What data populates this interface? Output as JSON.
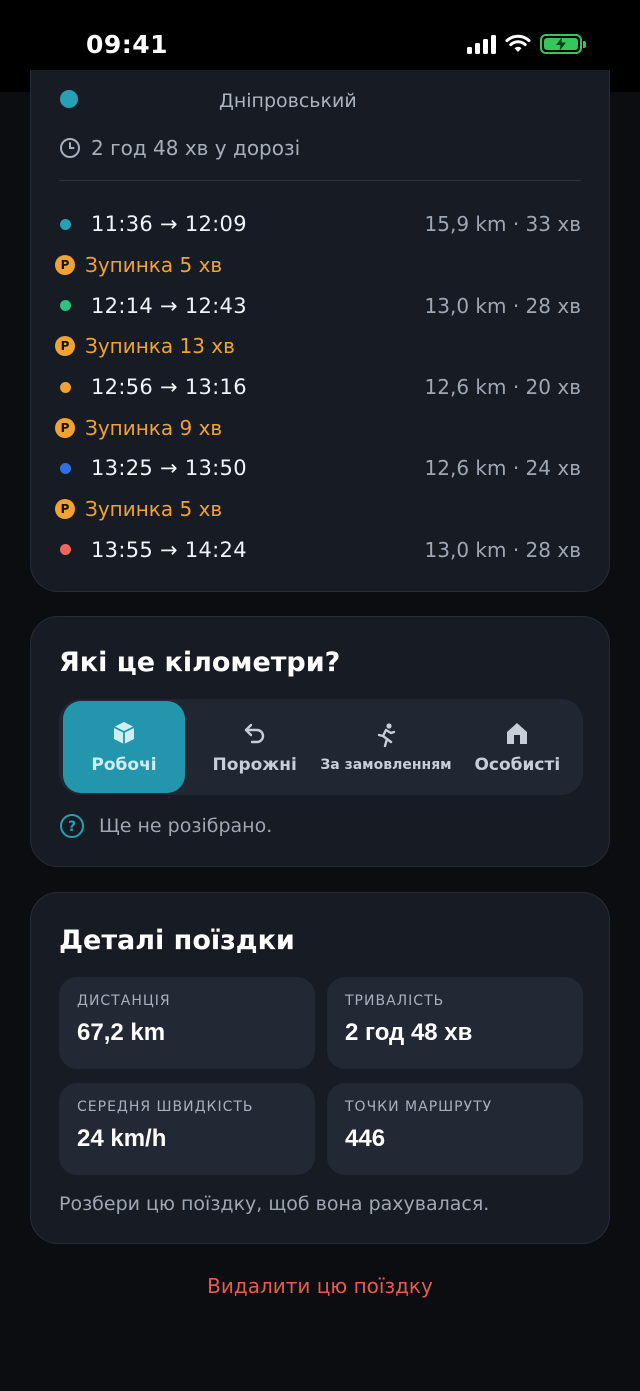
{
  "status": {
    "time": "09:41"
  },
  "trip": {
    "end_place": "Дніпровський",
    "duration_text": "2 год 48 хв у дорозі",
    "segments": [
      {
        "kind": "drive",
        "time": "11:36 → 12:09",
        "meta": "15,9 km · 33 хв",
        "color": "#26a0b5"
      },
      {
        "kind": "stop",
        "label": "Зупинка 5 хв"
      },
      {
        "kind": "drive",
        "time": "12:14 → 12:43",
        "meta": "13,0 km · 28 хв",
        "color": "#2ec27e"
      },
      {
        "kind": "stop",
        "label": "Зупинка 13 хв"
      },
      {
        "kind": "drive",
        "time": "12:56 → 13:16",
        "meta": "12,6 km · 20 хв",
        "color": "#f0a233"
      },
      {
        "kind": "stop",
        "label": "Зупинка 9 хв"
      },
      {
        "kind": "drive",
        "time": "13:25 → 13:50",
        "meta": "12,6 km · 24 хв",
        "color": "#2f6fe0"
      },
      {
        "kind": "stop",
        "label": "Зупинка 5 хв"
      },
      {
        "kind": "drive",
        "time": "13:55 → 14:24",
        "meta": "13,0 km · 28 хв",
        "color": "#f0665a"
      }
    ],
    "stop_badge": "P"
  },
  "category": {
    "title": "Які це кілометри?",
    "options": [
      {
        "label": "Робочі",
        "icon": "box-icon",
        "active": true
      },
      {
        "label": "Порожні",
        "icon": "return-arrow-icon",
        "active": false
      },
      {
        "label": "За замовленням",
        "icon": "running-person-icon",
        "active": false
      },
      {
        "label": "Особисті",
        "icon": "home-icon",
        "active": false
      }
    ],
    "hint": "Ще не розібрано."
  },
  "details": {
    "title": "Деталі поїздки",
    "stats": [
      {
        "label": "ДИСТАНЦІЯ",
        "value": "67,2 km"
      },
      {
        "label": "ТРИВАЛІСТЬ",
        "value": "2 год 48 хв"
      },
      {
        "label": "СЕРЕДНЯ ШВИДКІСТЬ",
        "value": "24 km/h"
      },
      {
        "label": "ТОЧКИ МАРШРУТУ",
        "value": "446"
      }
    ],
    "note": "Розбери цю поїздку, щоб вона рахувалася."
  },
  "delete_label": "Видалити цю поїздку",
  "colors": {
    "accent": "#2396ad",
    "stop": "#f0a233",
    "danger": "#e85c4f"
  }
}
